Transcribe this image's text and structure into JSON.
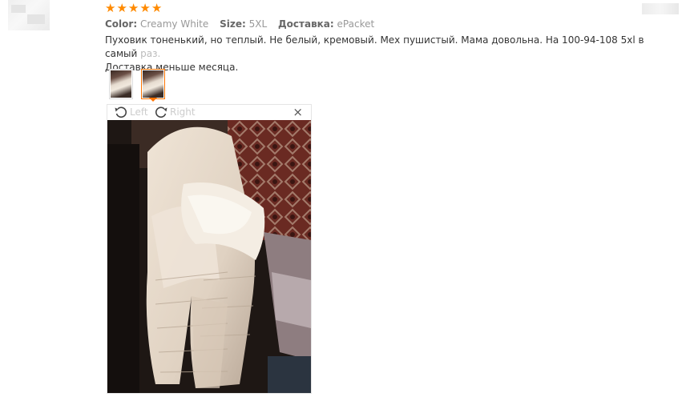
{
  "review": {
    "rating": 5,
    "meta": [
      {
        "key": "Color:",
        "value": "Creamy White"
      },
      {
        "key": "Size:",
        "value": "5XL"
      },
      {
        "key": "Доставка:",
        "value": "ePacket"
      }
    ],
    "text": "Пуховик тоненький, но теплый. Не белый, кремовый. Мех пушистый. Мама довольна. На 100-94-108 5xl в самый",
    "text_fade": " раз.",
    "text_line2": "Доставка меньше месяца."
  },
  "viewer": {
    "rotate_left_label": "Left",
    "rotate_right_label": "Right",
    "close_symbol": "×"
  },
  "colors": {
    "accent": "#ff7300",
    "star": "#ff8a00"
  }
}
